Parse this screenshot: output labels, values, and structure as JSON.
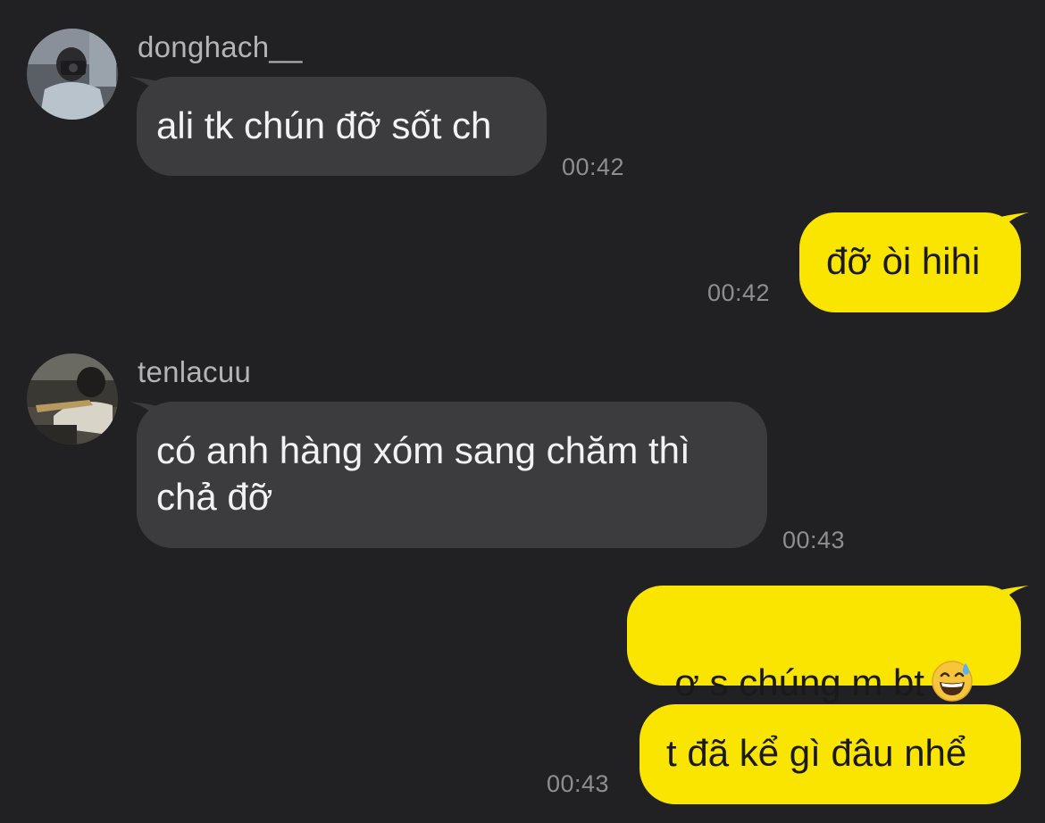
{
  "messages": [
    {
      "sender": "donghach__",
      "text": "ali tk chún đỡ sốt ch",
      "time": "00:42"
    },
    {
      "text": "đỡ òi hihi",
      "time": "00:42"
    },
    {
      "sender": "tenlacuu",
      "text": "có anh hàng xóm sang chăm thì\nchả đỡ",
      "time": "00:43"
    },
    {
      "text": "ơ s chúng m bt",
      "emoji": "grinning-face-with-sweat-icon"
    },
    {
      "text": "t đã kể gì đâu nhể",
      "time": "00:43"
    }
  ],
  "colors": {
    "background": "#212124",
    "incoming_bubble": "#3c3c3e",
    "outgoing_bubble": "#fae500",
    "timestamp": "#8e8e92",
    "sender_name": "#b4b4b8"
  }
}
